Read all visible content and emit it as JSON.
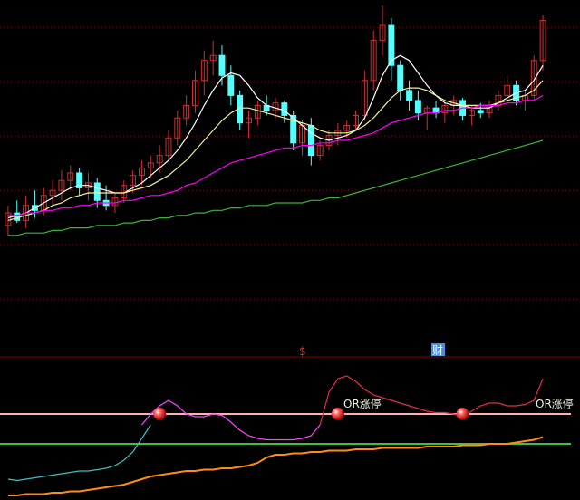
{
  "colors": {
    "background": "#000000",
    "grid": "#8b0000",
    "up_candle": "#c83232",
    "down_candle": "#54ffff",
    "ma_white": "#ffffff",
    "ma_yellow": "#f5f0a0",
    "ma_magenta": "#ff00ff",
    "ma_green": "#3cb43c",
    "osc_cyan": "#40c0c0",
    "osc_magenta": "#ff40ff",
    "osc_red": "#e03040",
    "osc_orange": "#ff8c1a",
    "level_pink": "#ffb0b0",
    "level_green": "#40c040",
    "marker_text": "#ffffff",
    "annotation_text": "#f0f0e0"
  },
  "markers": {
    "s_label": "$",
    "cai_label": "财"
  },
  "annotations": {
    "or_label_1": "OR涨停",
    "or_label_2": "OR涨停"
  },
  "icons": {
    "ball": "red-ball-icon"
  },
  "chart_data": [
    {
      "type": "candlestick",
      "title": "",
      "ylim": [
        0,
        100
      ],
      "grid": true,
      "candles": [
        {
          "o": 12,
          "h": 20,
          "l": 8,
          "c": 17
        },
        {
          "o": 17,
          "h": 22,
          "l": 13,
          "c": 14
        },
        {
          "o": 14,
          "h": 24,
          "l": 11,
          "c": 20
        },
        {
          "o": 20,
          "h": 26,
          "l": 15,
          "c": 18
        },
        {
          "o": 18,
          "h": 27,
          "l": 16,
          "c": 24
        },
        {
          "o": 24,
          "h": 30,
          "l": 20,
          "c": 26
        },
        {
          "o": 26,
          "h": 34,
          "l": 22,
          "c": 30
        },
        {
          "o": 30,
          "h": 36,
          "l": 26,
          "c": 33
        },
        {
          "o": 33,
          "h": 35,
          "l": 24,
          "c": 27
        },
        {
          "o": 27,
          "h": 33,
          "l": 22,
          "c": 29
        },
        {
          "o": 29,
          "h": 31,
          "l": 19,
          "c": 22
        },
        {
          "o": 22,
          "h": 28,
          "l": 18,
          "c": 20
        },
        {
          "o": 20,
          "h": 25,
          "l": 17,
          "c": 23
        },
        {
          "o": 23,
          "h": 30,
          "l": 21,
          "c": 28
        },
        {
          "o": 28,
          "h": 34,
          "l": 25,
          "c": 32
        },
        {
          "o": 32,
          "h": 38,
          "l": 28,
          "c": 35
        },
        {
          "o": 35,
          "h": 40,
          "l": 31,
          "c": 37
        },
        {
          "o": 37,
          "h": 44,
          "l": 33,
          "c": 40
        },
        {
          "o": 40,
          "h": 50,
          "l": 38,
          "c": 47
        },
        {
          "o": 47,
          "h": 58,
          "l": 44,
          "c": 55
        },
        {
          "o": 55,
          "h": 64,
          "l": 52,
          "c": 60
        },
        {
          "o": 60,
          "h": 74,
          "l": 57,
          "c": 70
        },
        {
          "o": 70,
          "h": 82,
          "l": 64,
          "c": 78
        },
        {
          "o": 78,
          "h": 86,
          "l": 72,
          "c": 80
        },
        {
          "o": 80,
          "h": 84,
          "l": 68,
          "c": 72
        },
        {
          "o": 72,
          "h": 76,
          "l": 60,
          "c": 64
        },
        {
          "o": 64,
          "h": 66,
          "l": 50,
          "c": 53
        },
        {
          "o": 53,
          "h": 58,
          "l": 47,
          "c": 55
        },
        {
          "o": 55,
          "h": 62,
          "l": 52,
          "c": 60
        },
        {
          "o": 60,
          "h": 64,
          "l": 56,
          "c": 58
        },
        {
          "o": 58,
          "h": 63,
          "l": 55,
          "c": 61
        },
        {
          "o": 61,
          "h": 62,
          "l": 53,
          "c": 56
        },
        {
          "o": 56,
          "h": 58,
          "l": 42,
          "c": 45
        },
        {
          "o": 45,
          "h": 54,
          "l": 40,
          "c": 52
        },
        {
          "o": 52,
          "h": 55,
          "l": 36,
          "c": 40
        },
        {
          "o": 40,
          "h": 46,
          "l": 38,
          "c": 44
        },
        {
          "o": 44,
          "h": 50,
          "l": 42,
          "c": 48
        },
        {
          "o": 48,
          "h": 53,
          "l": 44,
          "c": 50
        },
        {
          "o": 50,
          "h": 54,
          "l": 47,
          "c": 52
        },
        {
          "o": 52,
          "h": 58,
          "l": 50,
          "c": 56
        },
        {
          "o": 56,
          "h": 74,
          "l": 54,
          "c": 70
        },
        {
          "o": 70,
          "h": 90,
          "l": 66,
          "c": 86
        },
        {
          "o": 86,
          "h": 100,
          "l": 80,
          "c": 92
        },
        {
          "o": 92,
          "h": 95,
          "l": 70,
          "c": 76
        },
        {
          "o": 76,
          "h": 78,
          "l": 62,
          "c": 66
        },
        {
          "o": 66,
          "h": 70,
          "l": 58,
          "c": 62
        },
        {
          "o": 62,
          "h": 66,
          "l": 54,
          "c": 57
        },
        {
          "o": 57,
          "h": 60,
          "l": 50,
          "c": 59
        },
        {
          "o": 59,
          "h": 62,
          "l": 55,
          "c": 57
        },
        {
          "o": 57,
          "h": 61,
          "l": 53,
          "c": 60
        },
        {
          "o": 60,
          "h": 64,
          "l": 56,
          "c": 62
        },
        {
          "o": 62,
          "h": 63,
          "l": 54,
          "c": 56
        },
        {
          "o": 56,
          "h": 60,
          "l": 52,
          "c": 58
        },
        {
          "o": 58,
          "h": 61,
          "l": 55,
          "c": 57
        },
        {
          "o": 57,
          "h": 62,
          "l": 55,
          "c": 60
        },
        {
          "o": 60,
          "h": 66,
          "l": 58,
          "c": 64
        },
        {
          "o": 64,
          "h": 72,
          "l": 60,
          "c": 68
        },
        {
          "o": 68,
          "h": 70,
          "l": 60,
          "c": 62
        },
        {
          "o": 62,
          "h": 66,
          "l": 58,
          "c": 64
        },
        {
          "o": 64,
          "h": 80,
          "l": 62,
          "c": 78
        },
        {
          "o": 78,
          "h": 96,
          "l": 74,
          "c": 94
        }
      ],
      "moving_averages": [
        {
          "role": "fast",
          "color_key": "ma_white",
          "values": [
            15,
            16,
            17,
            19,
            21,
            23,
            25,
            27,
            28,
            28,
            27,
            26,
            25,
            25,
            27,
            29,
            32,
            35,
            38,
            42,
            47,
            53,
            60,
            66,
            71,
            73,
            72,
            68,
            63,
            60,
            59,
            58,
            55,
            52,
            49,
            47,
            46,
            47,
            48,
            50,
            55,
            63,
            72,
            78,
            80,
            78,
            73,
            68,
            64,
            61,
            60,
            60,
            59,
            59,
            59,
            61,
            63,
            65,
            66,
            70,
            76
          ]
        },
        {
          "role": "mid",
          "color_key": "ma_yellow",
          "values": [
            14,
            15,
            16,
            17,
            18,
            20,
            21,
            23,
            24,
            25,
            25,
            25,
            25,
            25,
            26,
            27,
            28,
            30,
            32,
            35,
            38,
            42,
            46,
            50,
            54,
            57,
            59,
            59,
            58,
            57,
            56,
            55,
            54,
            53,
            52,
            50,
            49,
            49,
            49,
            50,
            52,
            55,
            59,
            63,
            66,
            67,
            67,
            66,
            64,
            62,
            61,
            60,
            60,
            60,
            60,
            61,
            62,
            63,
            64,
            66,
            70
          ]
        },
        {
          "role": "slow",
          "color_key": "ma_magenta",
          "values": [
            16,
            16,
            17,
            17,
            18,
            18,
            19,
            19,
            20,
            20,
            21,
            21,
            21,
            22,
            22,
            23,
            24,
            24,
            25,
            26,
            28,
            29,
            31,
            33,
            35,
            37,
            38,
            39,
            40,
            41,
            42,
            43,
            43,
            44,
            44,
            45,
            45,
            46,
            46,
            47,
            48,
            49,
            51,
            53,
            54,
            55,
            56,
            57,
            57,
            58,
            58,
            59,
            59,
            60,
            60,
            60,
            61,
            61,
            62,
            62,
            64
          ]
        },
        {
          "role": "long",
          "color_key": "ma_green",
          "values": [
            8,
            8,
            9,
            9,
            9,
            10,
            10,
            11,
            11,
            11,
            12,
            12,
            12,
            13,
            13,
            14,
            14,
            15,
            15,
            16,
            16,
            17,
            17,
            18,
            18,
            19,
            19,
            20,
            20,
            20,
            21,
            21,
            21,
            21,
            22,
            22,
            23,
            23,
            24,
            25,
            26,
            27,
            28,
            29,
            30,
            31,
            32,
            33,
            34,
            35,
            36,
            37,
            38,
            39,
            40,
            41,
            42,
            43,
            44,
            45,
            46
          ]
        }
      ]
    },
    {
      "type": "line",
      "title": "",
      "ylim": [
        0,
        100
      ],
      "grid": false,
      "levels": [
        {
          "value": 62,
          "color_key": "level_pink"
        },
        {
          "value": 40,
          "color_key": "level_green"
        }
      ],
      "series": [
        {
          "color_key": "osc_cyan",
          "segment": "0-15",
          "values": [
            14,
            13,
            14,
            15,
            16,
            17,
            18,
            19,
            20,
            20,
            21,
            22,
            24,
            28,
            34,
            44,
            54
          ]
        },
        {
          "color_key": "osc_magenta",
          "segment": "15-35",
          "values": [
            54,
            62,
            68,
            72,
            68,
            62,
            60,
            60,
            62,
            61,
            56,
            50,
            46,
            44,
            43,
            43,
            43,
            43,
            44,
            46,
            54
          ]
        },
        {
          "color_key": "osc_red",
          "segment": "35-60",
          "values": [
            54,
            78,
            88,
            90,
            86,
            80,
            76,
            74,
            72,
            70,
            68,
            66,
            64,
            63,
            63,
            62,
            60,
            64,
            68,
            70,
            70,
            68,
            68,
            69,
            72,
            88
          ]
        },
        {
          "color_key": "osc_orange",
          "segment": "0-60",
          "values": [
            2,
            2,
            3,
            3,
            3,
            4,
            4,
            5,
            5,
            6,
            7,
            8,
            9,
            10,
            12,
            14,
            16,
            17,
            18,
            19,
            20,
            20,
            21,
            21,
            22,
            22,
            23,
            24,
            26,
            30,
            32,
            32,
            33,
            33,
            34,
            34,
            35,
            35,
            35,
            36,
            36,
            36,
            37,
            37,
            37,
            37,
            37,
            38,
            38,
            38,
            38,
            39,
            39,
            39,
            40,
            40,
            40,
            41,
            42,
            43,
            45
          ]
        }
      ],
      "signal_points": [
        17,
        37,
        51
      ]
    }
  ]
}
